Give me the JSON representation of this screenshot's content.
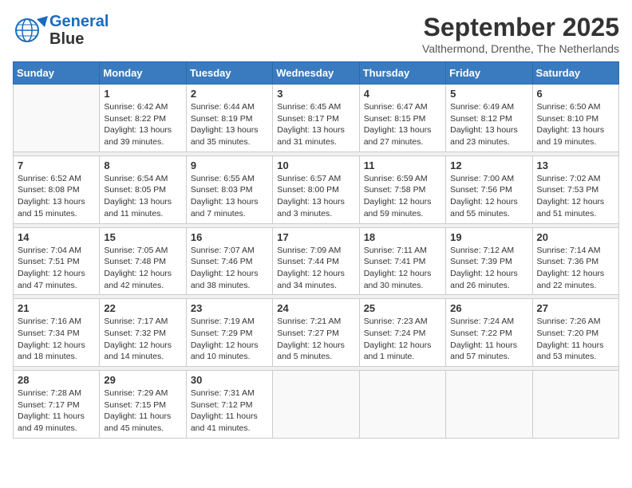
{
  "logo": {
    "line1": "General",
    "line2": "Blue"
  },
  "title": "September 2025",
  "subtitle": "Valthermond, Drenthe, The Netherlands",
  "weekdays": [
    "Sunday",
    "Monday",
    "Tuesday",
    "Wednesday",
    "Thursday",
    "Friday",
    "Saturday"
  ],
  "weeks": [
    [
      {
        "day": "",
        "info": ""
      },
      {
        "day": "1",
        "info": "Sunrise: 6:42 AM\nSunset: 8:22 PM\nDaylight: 13 hours\nand 39 minutes."
      },
      {
        "day": "2",
        "info": "Sunrise: 6:44 AM\nSunset: 8:19 PM\nDaylight: 13 hours\nand 35 minutes."
      },
      {
        "day": "3",
        "info": "Sunrise: 6:45 AM\nSunset: 8:17 PM\nDaylight: 13 hours\nand 31 minutes."
      },
      {
        "day": "4",
        "info": "Sunrise: 6:47 AM\nSunset: 8:15 PM\nDaylight: 13 hours\nand 27 minutes."
      },
      {
        "day": "5",
        "info": "Sunrise: 6:49 AM\nSunset: 8:12 PM\nDaylight: 13 hours\nand 23 minutes."
      },
      {
        "day": "6",
        "info": "Sunrise: 6:50 AM\nSunset: 8:10 PM\nDaylight: 13 hours\nand 19 minutes."
      }
    ],
    [
      {
        "day": "7",
        "info": "Sunrise: 6:52 AM\nSunset: 8:08 PM\nDaylight: 13 hours\nand 15 minutes."
      },
      {
        "day": "8",
        "info": "Sunrise: 6:54 AM\nSunset: 8:05 PM\nDaylight: 13 hours\nand 11 minutes."
      },
      {
        "day": "9",
        "info": "Sunrise: 6:55 AM\nSunset: 8:03 PM\nDaylight: 13 hours\nand 7 minutes."
      },
      {
        "day": "10",
        "info": "Sunrise: 6:57 AM\nSunset: 8:00 PM\nDaylight: 13 hours\nand 3 minutes."
      },
      {
        "day": "11",
        "info": "Sunrise: 6:59 AM\nSunset: 7:58 PM\nDaylight: 12 hours\nand 59 minutes."
      },
      {
        "day": "12",
        "info": "Sunrise: 7:00 AM\nSunset: 7:56 PM\nDaylight: 12 hours\nand 55 minutes."
      },
      {
        "day": "13",
        "info": "Sunrise: 7:02 AM\nSunset: 7:53 PM\nDaylight: 12 hours\nand 51 minutes."
      }
    ],
    [
      {
        "day": "14",
        "info": "Sunrise: 7:04 AM\nSunset: 7:51 PM\nDaylight: 12 hours\nand 47 minutes."
      },
      {
        "day": "15",
        "info": "Sunrise: 7:05 AM\nSunset: 7:48 PM\nDaylight: 12 hours\nand 42 minutes."
      },
      {
        "day": "16",
        "info": "Sunrise: 7:07 AM\nSunset: 7:46 PM\nDaylight: 12 hours\nand 38 minutes."
      },
      {
        "day": "17",
        "info": "Sunrise: 7:09 AM\nSunset: 7:44 PM\nDaylight: 12 hours\nand 34 minutes."
      },
      {
        "day": "18",
        "info": "Sunrise: 7:11 AM\nSunset: 7:41 PM\nDaylight: 12 hours\nand 30 minutes."
      },
      {
        "day": "19",
        "info": "Sunrise: 7:12 AM\nSunset: 7:39 PM\nDaylight: 12 hours\nand 26 minutes."
      },
      {
        "day": "20",
        "info": "Sunrise: 7:14 AM\nSunset: 7:36 PM\nDaylight: 12 hours\nand 22 minutes."
      }
    ],
    [
      {
        "day": "21",
        "info": "Sunrise: 7:16 AM\nSunset: 7:34 PM\nDaylight: 12 hours\nand 18 minutes."
      },
      {
        "day": "22",
        "info": "Sunrise: 7:17 AM\nSunset: 7:32 PM\nDaylight: 12 hours\nand 14 minutes."
      },
      {
        "day": "23",
        "info": "Sunrise: 7:19 AM\nSunset: 7:29 PM\nDaylight: 12 hours\nand 10 minutes."
      },
      {
        "day": "24",
        "info": "Sunrise: 7:21 AM\nSunset: 7:27 PM\nDaylight: 12 hours\nand 5 minutes."
      },
      {
        "day": "25",
        "info": "Sunrise: 7:23 AM\nSunset: 7:24 PM\nDaylight: 12 hours\nand 1 minute."
      },
      {
        "day": "26",
        "info": "Sunrise: 7:24 AM\nSunset: 7:22 PM\nDaylight: 11 hours\nand 57 minutes."
      },
      {
        "day": "27",
        "info": "Sunrise: 7:26 AM\nSunset: 7:20 PM\nDaylight: 11 hours\nand 53 minutes."
      }
    ],
    [
      {
        "day": "28",
        "info": "Sunrise: 7:28 AM\nSunset: 7:17 PM\nDaylight: 11 hours\nand 49 minutes."
      },
      {
        "day": "29",
        "info": "Sunrise: 7:29 AM\nSunset: 7:15 PM\nDaylight: 11 hours\nand 45 minutes."
      },
      {
        "day": "30",
        "info": "Sunrise: 7:31 AM\nSunset: 7:12 PM\nDaylight: 11 hours\nand 41 minutes."
      },
      {
        "day": "",
        "info": ""
      },
      {
        "day": "",
        "info": ""
      },
      {
        "day": "",
        "info": ""
      },
      {
        "day": "",
        "info": ""
      }
    ]
  ]
}
